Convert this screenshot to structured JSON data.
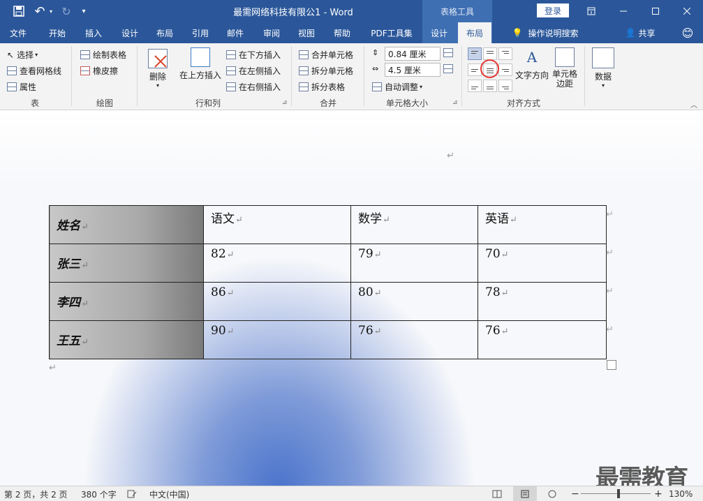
{
  "titlebar": {
    "title": "最需网络科技有限公1 - Word",
    "context_tools": "表格工具",
    "login": "登录",
    "undo_icon": "↶",
    "redo_icon": "↻",
    "save_icon": "save-icon",
    "qat_more": "▾"
  },
  "tabs": [
    {
      "label": "文件"
    },
    {
      "label": "开始"
    },
    {
      "label": "插入"
    },
    {
      "label": "设计"
    },
    {
      "label": "布局"
    },
    {
      "label": "引用"
    },
    {
      "label": "邮件"
    },
    {
      "label": "审阅"
    },
    {
      "label": "视图"
    },
    {
      "label": "帮助"
    },
    {
      "label": "PDF工具集"
    },
    {
      "label": "设计"
    },
    {
      "label": "布局"
    }
  ],
  "tell_me": "操作说明搜索",
  "share": "共享",
  "ribbon": {
    "table_group": {
      "label": "表",
      "select": "选择",
      "gridlines": "查看网格线",
      "properties": "属性"
    },
    "draw_group": {
      "label": "绘图",
      "draw_table": "绘制表格",
      "eraser": "橡皮擦"
    },
    "rows_group": {
      "label": "行和列",
      "delete": "删除",
      "insert_above": "在上方插入",
      "insert_below": "在下方插入",
      "insert_left": "在左侧插入",
      "insert_right": "在右侧插入"
    },
    "merge_group": {
      "label": "合并",
      "merge_cells": "合并单元格",
      "split_cells": "拆分单元格",
      "split_table": "拆分表格"
    },
    "size_group": {
      "label": "单元格大小",
      "height": "0.84 厘米",
      "width": "4.5 厘米",
      "autofit": "自动调整"
    },
    "align_group": {
      "label": "对齐方式",
      "text_direction": "文字方向",
      "cell_margins": "单元格\n边距"
    },
    "data_group": {
      "label": "数据"
    }
  },
  "table": {
    "header": [
      "姓名",
      "语文",
      "数学",
      "英语"
    ],
    "rows": [
      [
        "张三",
        "82",
        "79",
        "70"
      ],
      [
        "李四",
        "86",
        "80",
        "78"
      ],
      [
        "王五",
        "90",
        "76",
        "76"
      ]
    ]
  },
  "para_mark": "↵",
  "status": {
    "page": "第 2 页，共 2 页",
    "words": "380 个字",
    "language": "中文(中国)",
    "zoom": "130%"
  },
  "watermark": "最需教育"
}
